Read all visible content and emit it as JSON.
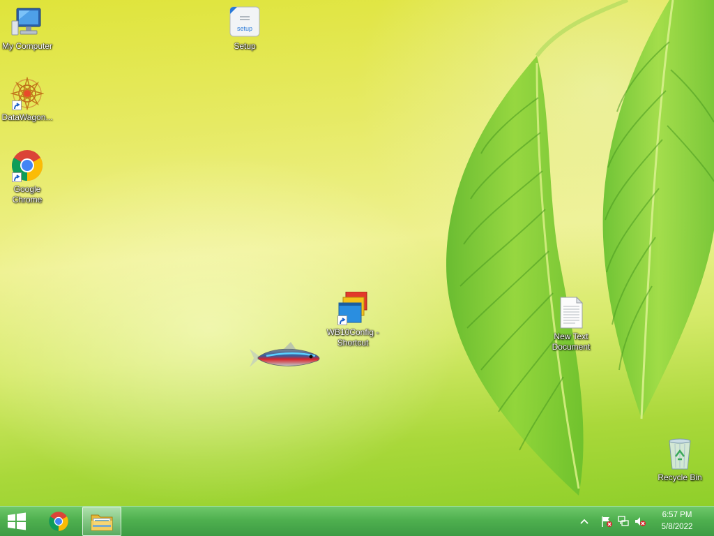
{
  "desktop": {
    "icons": [
      {
        "label": "My Computer"
      },
      {
        "label": "DataWagon..."
      },
      {
        "label": "Google Chrome"
      },
      {
        "label": "Setup"
      },
      {
        "label": "WB10Config - Shortcut"
      },
      {
        "label": "New Text Document"
      },
      {
        "label": "Recycle Bin"
      }
    ],
    "setup_icon_text": "setup"
  },
  "taskbar": {
    "pinned": [
      {
        "icon": "chrome-icon"
      },
      {
        "icon": "file-explorer-icon",
        "active": true
      }
    ],
    "tray": {
      "icons": [
        "show-hidden-icons-chevron-icon",
        "action-center-flag-icon",
        "network-icon",
        "volume-muted-icon"
      ],
      "time": "6:57 PM",
      "date": "5/8/2022"
    }
  },
  "colors": {
    "taskbar": "#4fb04f",
    "desktop_yellow": "#e6ea63",
    "desktop_green": "#8fcf2a",
    "start_blue": "#1f5fbf"
  }
}
